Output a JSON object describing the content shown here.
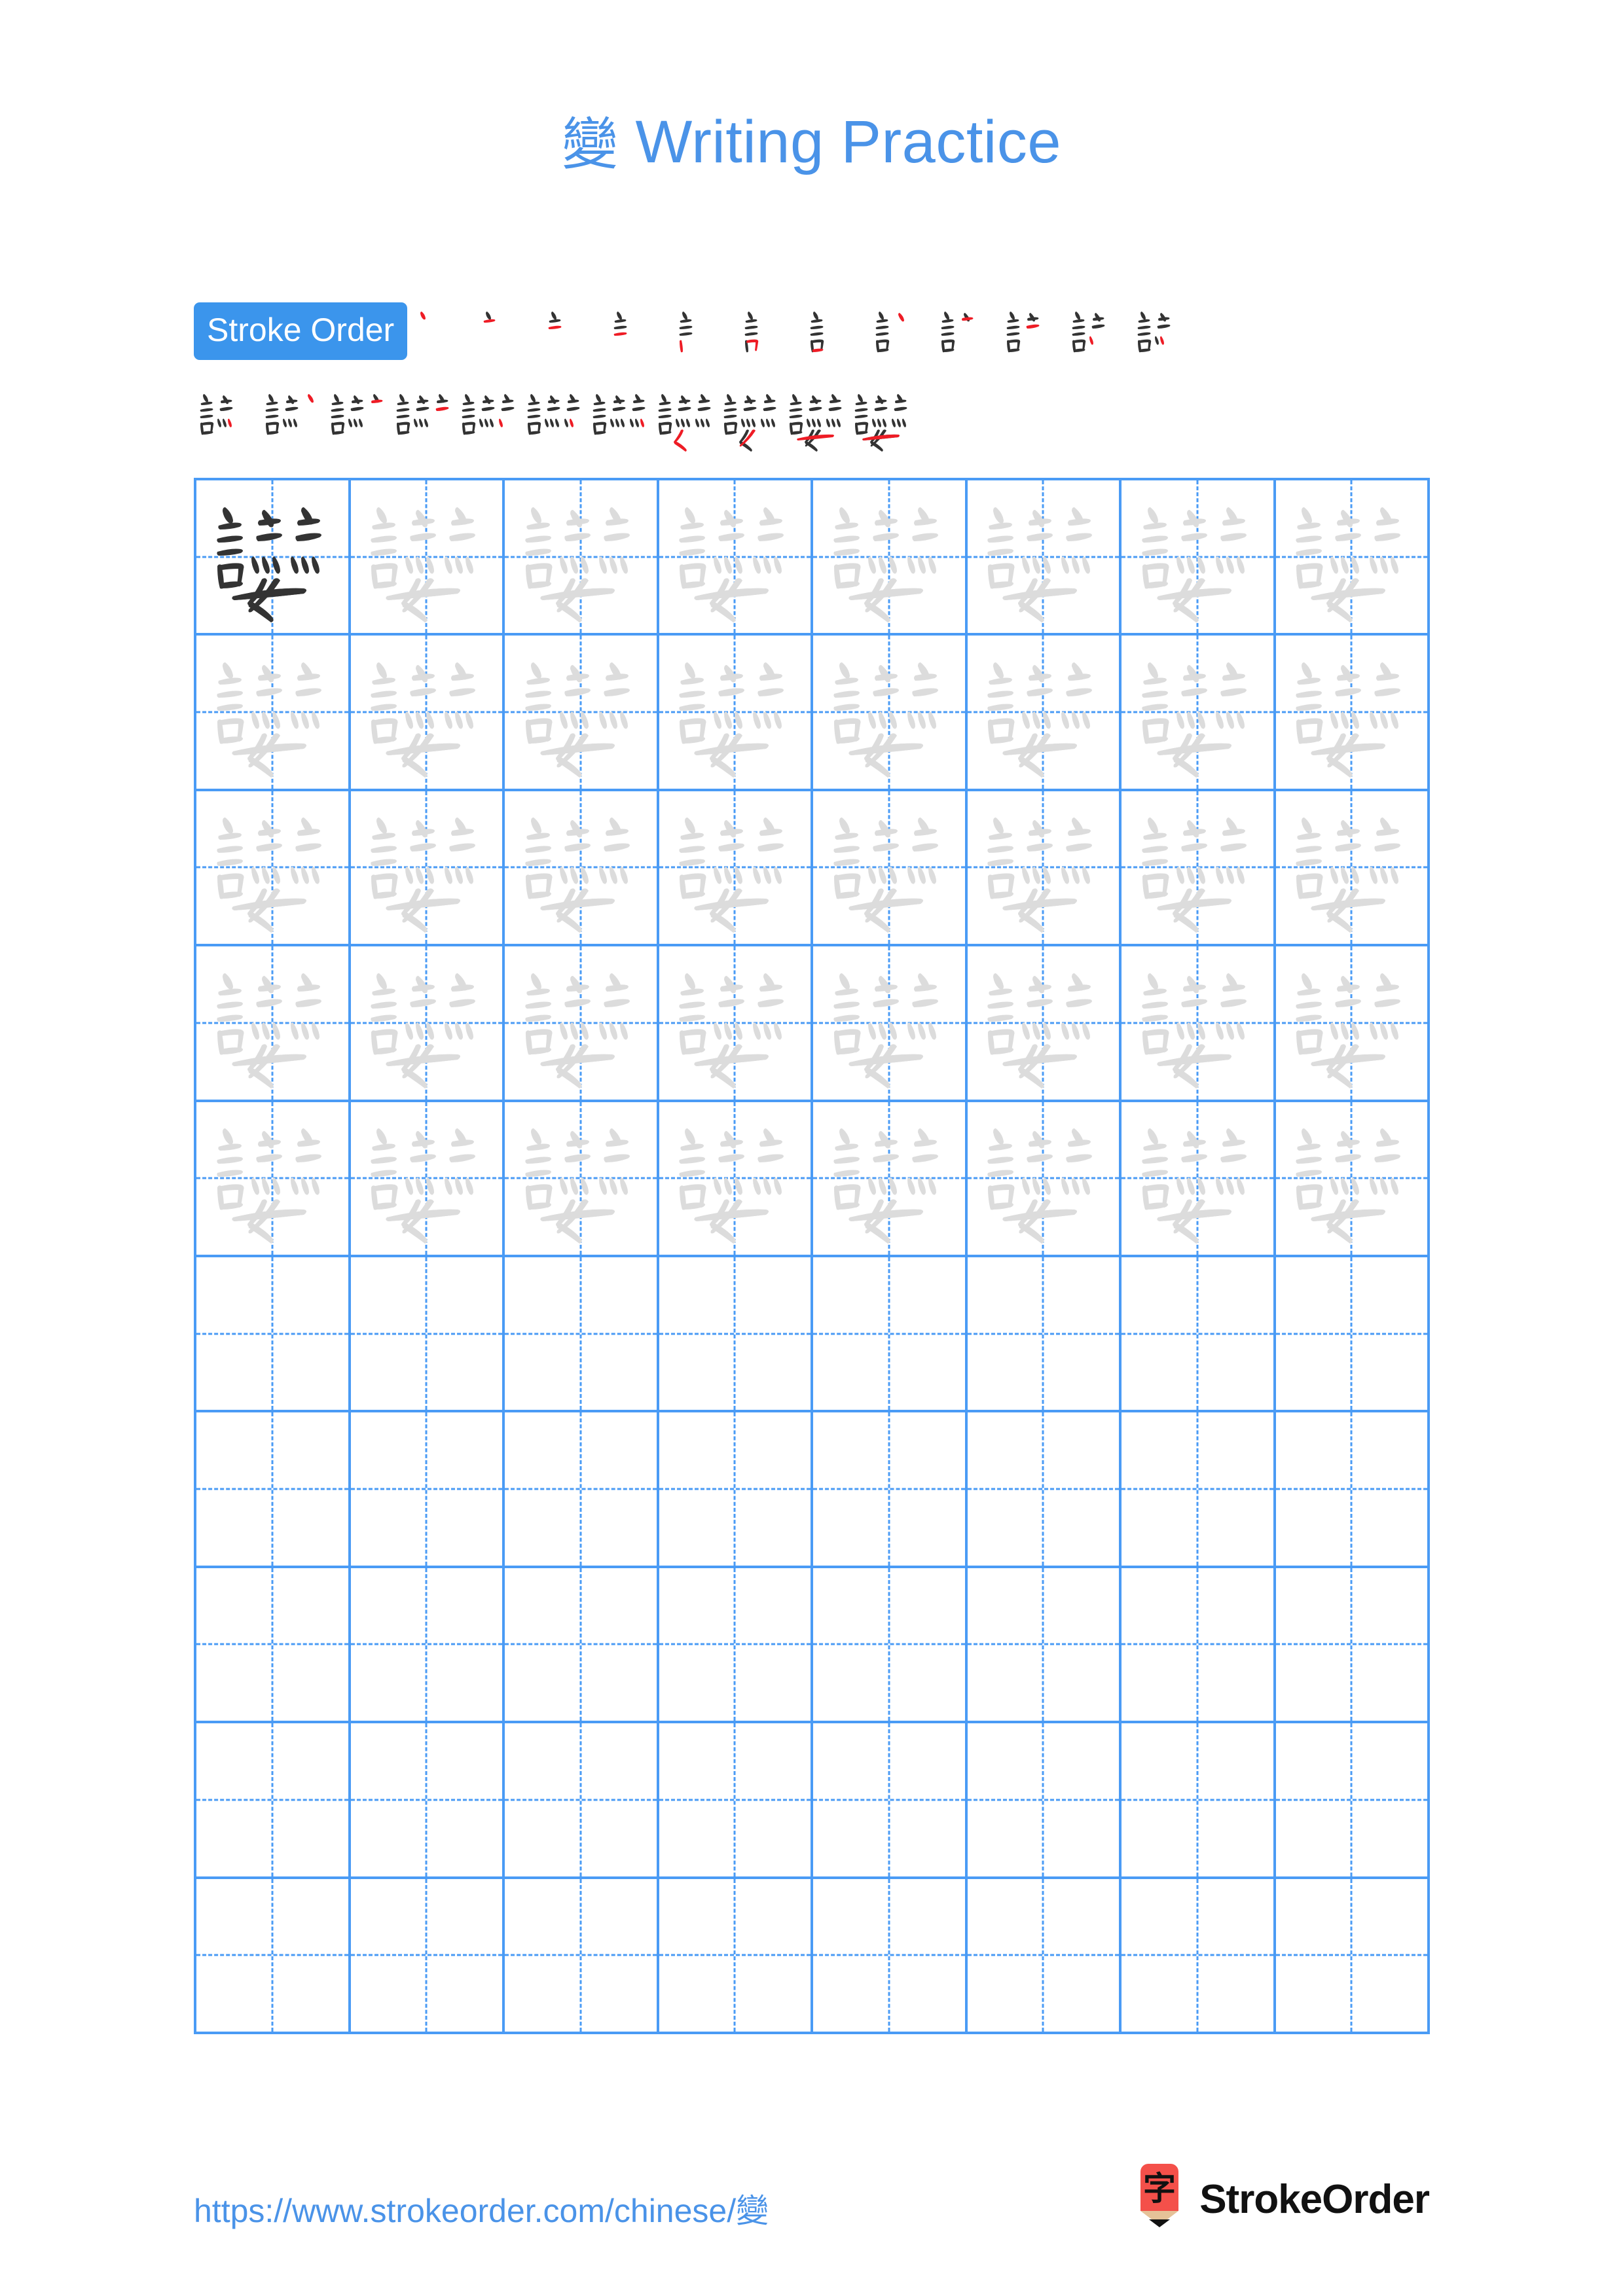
{
  "document": {
    "character": "變",
    "title_suffix": " Writing Practice",
    "title_full": "變 Writing Practice",
    "title_color": "#4a93e8"
  },
  "stroke_order": {
    "badge_label": "Stroke Order",
    "badge_bg": "#3b95ec",
    "badge_text_color": "#ffffff",
    "total_strokes": 23,
    "new_stroke_color": "#ee1c25",
    "existing_stroke_color": "#333333",
    "row1_count": 12,
    "row2_count": 11,
    "steps": [
      1,
      2,
      3,
      4,
      5,
      6,
      7,
      8,
      9,
      10,
      11,
      12,
      13,
      14,
      15,
      16,
      17,
      18,
      19,
      20,
      21,
      22,
      23
    ]
  },
  "practice_grid": {
    "columns": 8,
    "rows": 10,
    "grid_line_color": "#4a9bf5",
    "guide_line_color": "#4a9bf5",
    "model_char_color": "#333333",
    "trace_char_color": "#dcdcdc",
    "filled_rows": 5,
    "empty_rows": 5,
    "character": "變"
  },
  "footer": {
    "url": "https://www.strokeorder.com/chinese/變",
    "url_color": "#4a93e8",
    "brand_name": "StrokeOrder",
    "logo_char": "字",
    "logo_body_color": "#f4504a",
    "logo_wood_color": "#e5c298",
    "logo_tip_color": "#111111"
  }
}
